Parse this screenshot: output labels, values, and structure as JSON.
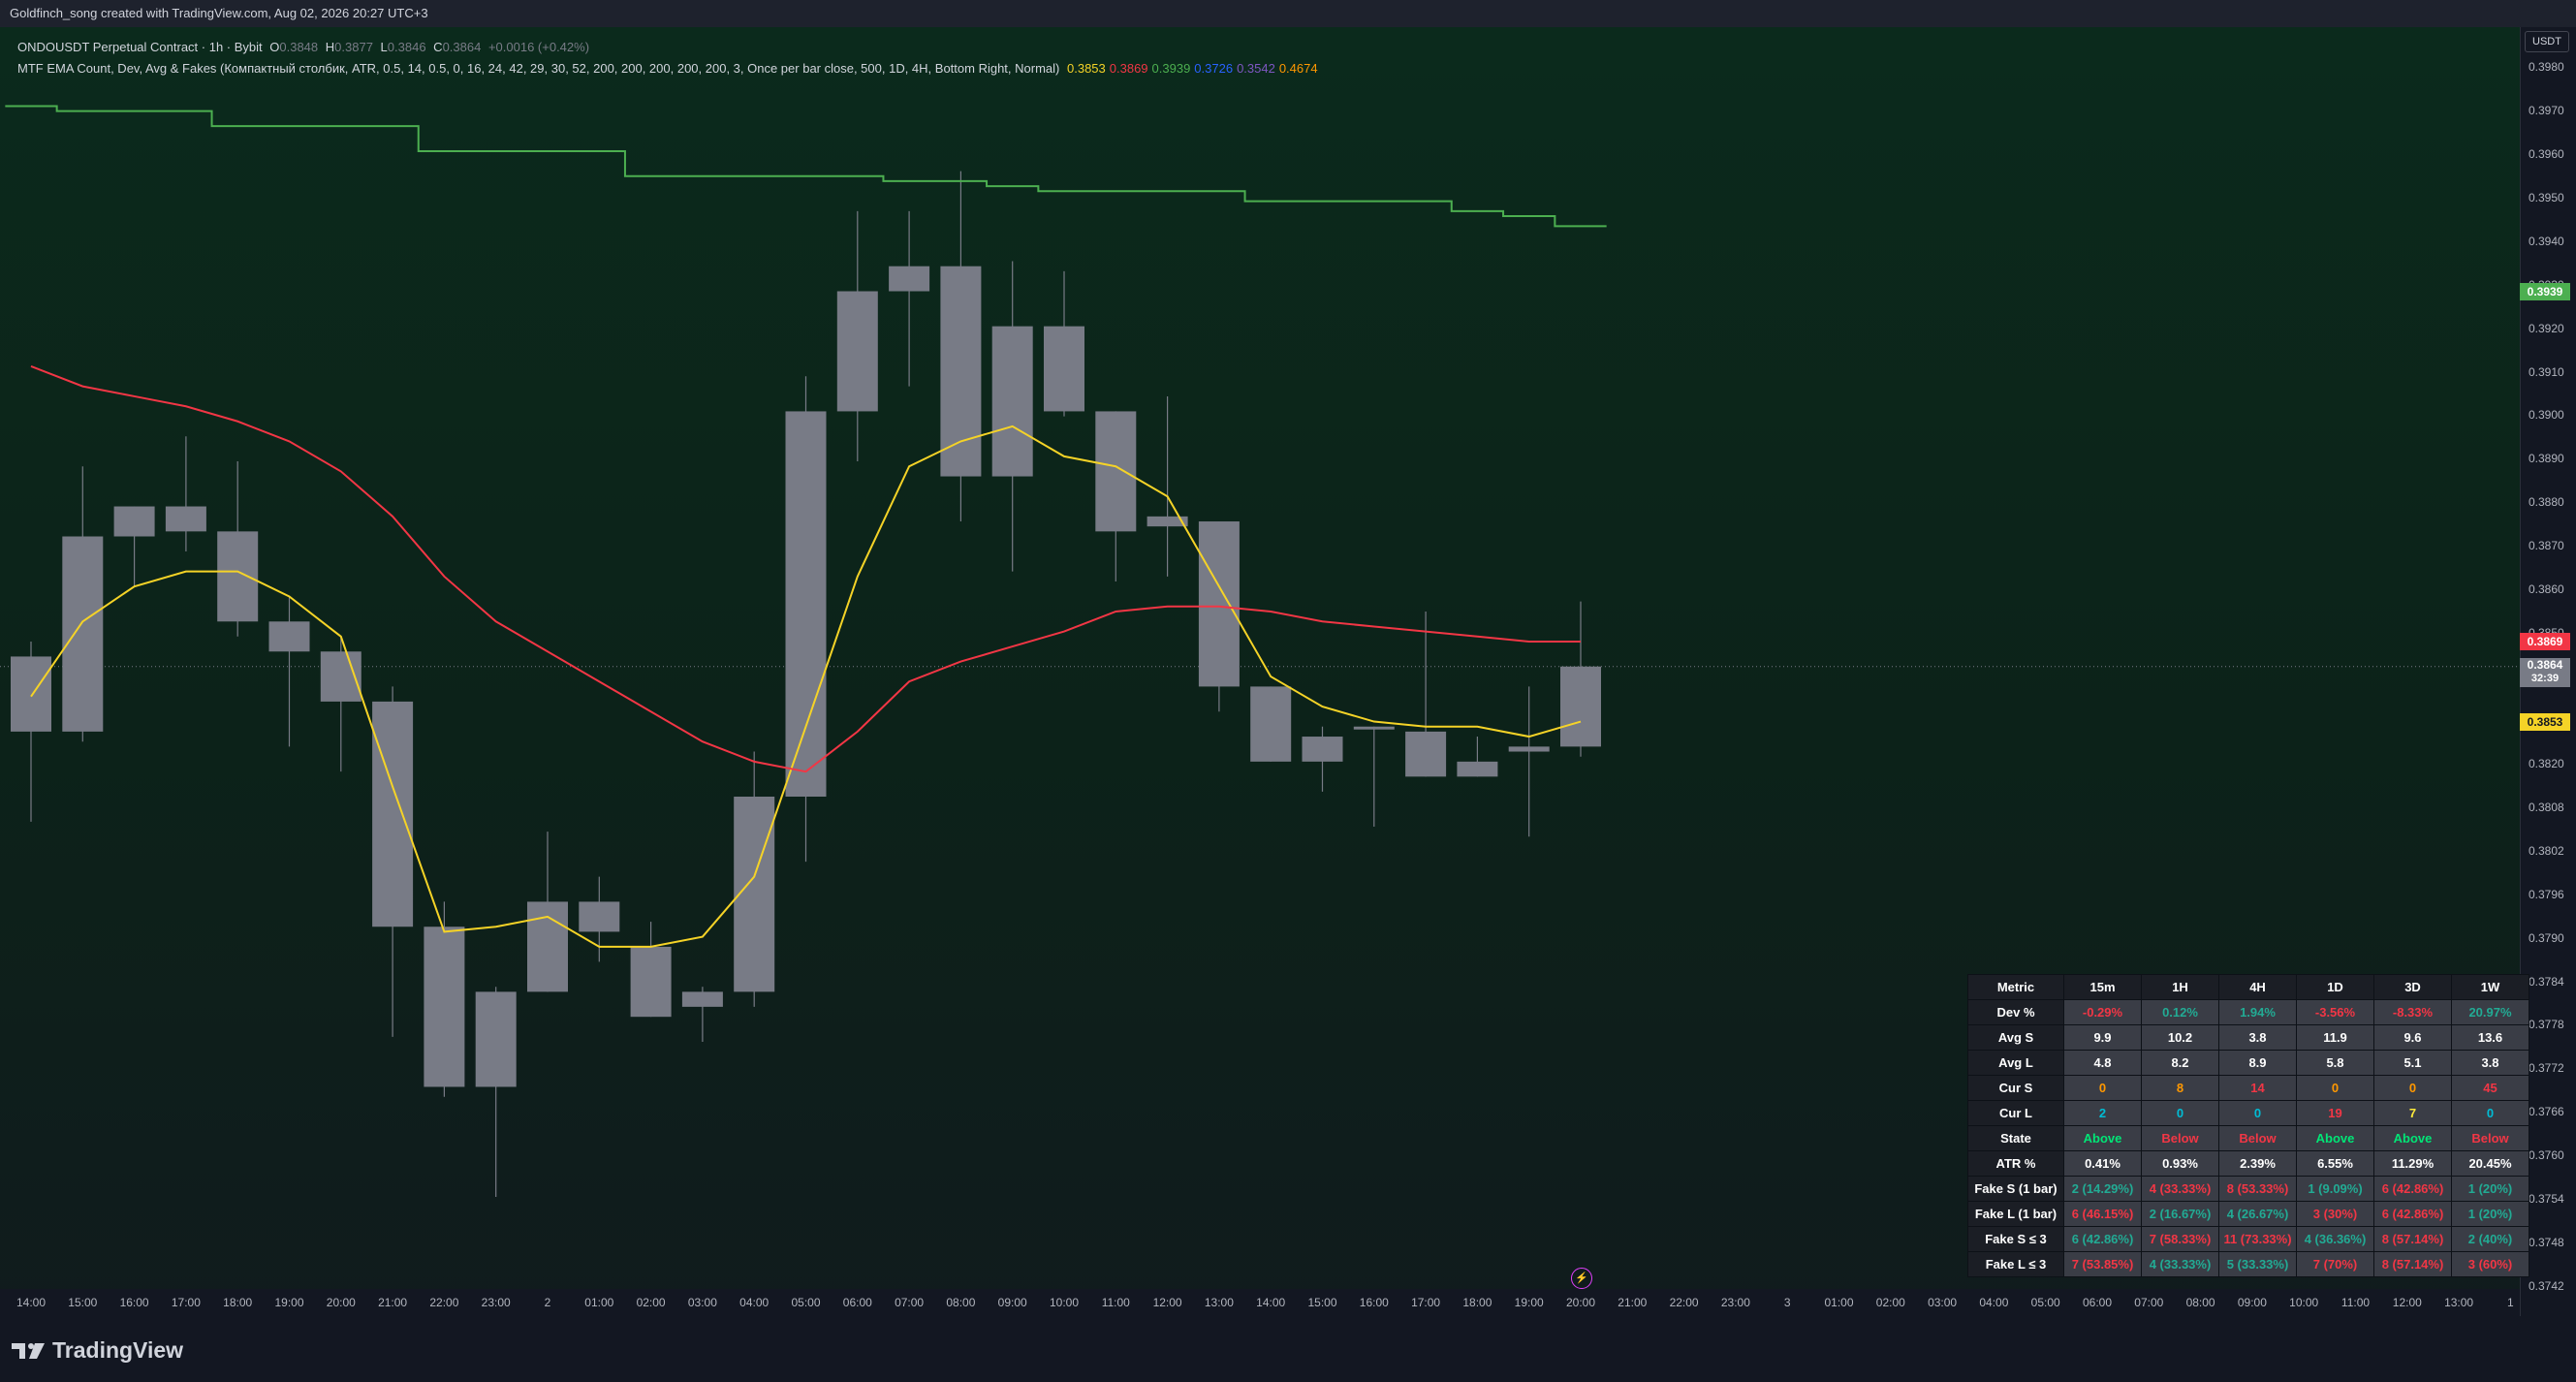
{
  "header": {
    "credit": "Goldfinch_song created with TradingView.com, Aug 02, 2026 20:27 UTC+3"
  },
  "legend": {
    "symbol_line": "ONDOUSDT Perpetual Contract · 1h · Bybit",
    "ohlc": {
      "o_label": "O",
      "o": "0.3848",
      "h_label": "H",
      "h": "0.3877",
      "l_label": "L",
      "l": "0.3846",
      "c_label": "C",
      "c": "0.3864",
      "change": "+0.0016 (+0.42%)"
    },
    "indicator_line": "MTF EMA Count, Dev, Avg & Fakes (Компактный столбик, ATR, 0.5, 14, 0.5, 0, 16, 24, 42, 29, 30, 52, 200, 200, 200, 200, 200, 3, Once per bar close, 500, 1D, 4H, Bottom Right, Normal)",
    "indicator_values": [
      {
        "text": "0.3853",
        "color": "#f5d327"
      },
      {
        "text": "0.3869",
        "color": "#f23645"
      },
      {
        "text": "0.3939",
        "color": "#4caf50"
      },
      {
        "text": "0.3726",
        "color": "#2962ff"
      },
      {
        "text": "0.3542",
        "color": "#7e57c2"
      },
      {
        "text": "0.4674",
        "color": "#ff9800"
      }
    ]
  },
  "price_axis": {
    "currency": "USDT",
    "ticks": [
      "0.3980",
      "0.3970",
      "0.3960",
      "0.3950",
      "0.3940",
      "0.3930",
      "0.3920",
      "0.3910",
      "0.3900",
      "0.3890",
      "0.3880",
      "0.3870",
      "0.3860",
      "0.3850",
      "0.3840",
      "0.3830",
      "0.3820",
      "0.3808",
      "0.3802",
      "0.3796",
      "0.3790",
      "0.3784",
      "0.3778",
      "0.3772",
      "0.3766",
      "0.3760",
      "0.3754",
      "0.3748",
      "0.3742"
    ],
    "tags": [
      {
        "text": "0.3939",
        "bg": "#4caf50",
        "fg": "#ffffff",
        "price": 0.3939
      },
      {
        "text": "0.3869",
        "bg": "#f23645",
        "fg": "#ffffff",
        "price": 0.3869
      },
      {
        "text": "0.3864",
        "sub": "32:39",
        "bg": "#787b86",
        "fg": "#ffffff",
        "price": 0.3864
      },
      {
        "text": "0.3853",
        "bg": "#f5d327",
        "fg": "#131722",
        "price": 0.3853
      }
    ]
  },
  "time_axis": {
    "labels": [
      "14:00",
      "15:00",
      "16:00",
      "17:00",
      "18:00",
      "19:00",
      "20:00",
      "21:00",
      "22:00",
      "23:00",
      "2",
      "01:00",
      "02:00",
      "03:00",
      "04:00",
      "05:00",
      "06:00",
      "07:00",
      "08:00",
      "09:00",
      "10:00",
      "11:00",
      "12:00",
      "13:00",
      "14:00",
      "15:00",
      "16:00",
      "17:00",
      "18:00",
      "19:00",
      "20:00",
      "21:00",
      "22:00",
      "23:00",
      "3",
      "01:00",
      "02:00",
      "03:00",
      "04:00",
      "05:00",
      "06:00",
      "07:00",
      "08:00",
      "09:00",
      "10:00",
      "11:00",
      "12:00",
      "13:00",
      "1"
    ]
  },
  "chart_data": {
    "type": "candlestick",
    "candle_color": "#787b86",
    "categories": [
      "14:00",
      "15:00",
      "16:00",
      "17:00",
      "18:00",
      "19:00",
      "20:00",
      "21:00",
      "22:00",
      "23:00",
      "2",
      "01:00",
      "02:00",
      "03:00",
      "04:00",
      "05:00",
      "06:00",
      "07:00",
      "08:00",
      "09:00",
      "10:00",
      "11:00",
      "12:00",
      "13:00",
      "14:00",
      "15:00",
      "16:00",
      "17:00",
      "18:00",
      "19:00",
      "20:00"
    ],
    "ohlc": [
      [
        0.3866,
        0.3869,
        0.3833,
        0.3851
      ],
      [
        0.3851,
        0.3904,
        0.3849,
        0.389
      ],
      [
        0.389,
        0.3896,
        0.388,
        0.3896
      ],
      [
        0.3896,
        0.391,
        0.3887,
        0.3891
      ],
      [
        0.3891,
        0.3905,
        0.387,
        0.3873
      ],
      [
        0.3873,
        0.3878,
        0.3848,
        0.3867
      ],
      [
        0.3867,
        0.387,
        0.3843,
        0.3857
      ],
      [
        0.3857,
        0.386,
        0.379,
        0.3812
      ],
      [
        0.3812,
        0.3817,
        0.3778,
        0.378
      ],
      [
        0.378,
        0.38,
        0.3758,
        0.3799
      ],
      [
        0.3799,
        0.3831,
        0.3799,
        0.3817
      ],
      [
        0.3817,
        0.3822,
        0.3805,
        0.3811
      ],
      [
        0.3808,
        0.3813,
        0.3794,
        0.3794
      ],
      [
        0.3796,
        0.38,
        0.3789,
        0.3799
      ],
      [
        0.3799,
        0.3847,
        0.3796,
        0.3838
      ],
      [
        0.3838,
        0.3922,
        0.3825,
        0.3915
      ],
      [
        0.3915,
        0.3955,
        0.3905,
        0.3939
      ],
      [
        0.3939,
        0.3955,
        0.392,
        0.3944
      ],
      [
        0.3944,
        0.3963,
        0.3893,
        0.3902
      ],
      [
        0.3902,
        0.3945,
        0.3883,
        0.3932
      ],
      [
        0.3932,
        0.3943,
        0.3914,
        0.3915
      ],
      [
        0.3915,
        0.3915,
        0.3881,
        0.3891
      ],
      [
        0.3892,
        0.3918,
        0.3882,
        0.3894
      ],
      [
        0.3893,
        0.3893,
        0.3855,
        0.386
      ],
      [
        0.386,
        0.386,
        0.3845,
        0.3845
      ],
      [
        0.3845,
        0.3852,
        0.3839,
        0.385
      ],
      [
        0.3852,
        0.3852,
        0.3832,
        0.3852
      ],
      [
        0.3851,
        0.3875,
        0.3842,
        0.3842
      ],
      [
        0.3842,
        0.385,
        0.3842,
        0.3845
      ],
      [
        0.3847,
        0.386,
        0.383,
        0.3848
      ],
      [
        0.3848,
        0.3877,
        0.3846,
        0.3864
      ]
    ],
    "series": [
      {
        "color": "#f5d327",
        "values": [
          0.3858,
          0.3873,
          0.388,
          0.3883,
          0.3883,
          0.3878,
          0.387,
          0.384,
          0.3811,
          0.3812,
          0.3814,
          0.3808,
          0.3808,
          0.381,
          0.3822,
          0.3852,
          0.3882,
          0.3904,
          0.3909,
          0.3912,
          0.3906,
          0.3904,
          0.3898,
          0.388,
          0.3862,
          0.3856,
          0.3853,
          0.3852,
          0.3852,
          0.385,
          0.3853
        ]
      },
      {
        "color": "#f23645",
        "values": [
          0.3924,
          0.392,
          0.3918,
          0.3916,
          0.3913,
          0.3909,
          0.3903,
          0.3894,
          0.3882,
          0.3873,
          0.3867,
          0.3861,
          0.3855,
          0.3849,
          0.3845,
          0.3843,
          0.3851,
          0.3861,
          0.3865,
          0.3868,
          0.3871,
          0.3875,
          0.3876,
          0.3876,
          0.3875,
          0.3873,
          0.3872,
          0.3871,
          0.387,
          0.3869,
          0.3869
        ]
      },
      {
        "color": "#4caf50",
        "values": [
          0.3976,
          0.3975,
          0.3975,
          0.3975,
          0.3972,
          0.3972,
          0.3972,
          0.3972,
          0.3967,
          0.3967,
          0.3967,
          0.3967,
          0.3962,
          0.3962,
          0.3962,
          0.3962,
          0.3962,
          0.3961,
          0.3961,
          0.396,
          0.3959,
          0.3959,
          0.3959,
          0.3959,
          0.3957,
          0.3957,
          0.3957,
          0.3957,
          0.3955,
          0.3954,
          0.3952
        ]
      }
    ],
    "ylim": [
      0.374,
      0.3985
    ]
  },
  "table": {
    "headers": [
      "Metric",
      "15m",
      "1H",
      "4H",
      "1D",
      "3D",
      "1W"
    ],
    "rows": [
      {
        "metric": "Dev %",
        "cells": [
          {
            "t": "-0.29%",
            "c": "#f23645"
          },
          {
            "t": "0.12%",
            "c": "#22ab94"
          },
          {
            "t": "1.94%",
            "c": "#22ab94"
          },
          {
            "t": "-3.56%",
            "c": "#f23645"
          },
          {
            "t": "-8.33%",
            "c": "#f23645"
          },
          {
            "t": "20.97%",
            "c": "#22ab94"
          }
        ]
      },
      {
        "metric": "Avg S",
        "cells": [
          {
            "t": "9.9",
            "c": "#ffffff"
          },
          {
            "t": "10.2",
            "c": "#ffffff"
          },
          {
            "t": "3.8",
            "c": "#ffffff"
          },
          {
            "t": "11.9",
            "c": "#ffffff"
          },
          {
            "t": "9.6",
            "c": "#ffffff"
          },
          {
            "t": "13.6",
            "c": "#ffffff"
          }
        ]
      },
      {
        "metric": "Avg L",
        "cells": [
          {
            "t": "4.8",
            "c": "#ffffff"
          },
          {
            "t": "8.2",
            "c": "#ffffff"
          },
          {
            "t": "8.9",
            "c": "#ffffff"
          },
          {
            "t": "5.8",
            "c": "#ffffff"
          },
          {
            "t": "5.1",
            "c": "#ffffff"
          },
          {
            "t": "3.8",
            "c": "#ffffff"
          }
        ]
      },
      {
        "metric": "Cur S",
        "cells": [
          {
            "t": "0",
            "c": "#ff9800"
          },
          {
            "t": "8",
            "c": "#ff9800"
          },
          {
            "t": "14",
            "c": "#f23645"
          },
          {
            "t": "0",
            "c": "#ff9800"
          },
          {
            "t": "0",
            "c": "#ff9800"
          },
          {
            "t": "45",
            "c": "#f23645"
          }
        ]
      },
      {
        "metric": "Cur L",
        "cells": [
          {
            "t": "2",
            "c": "#00bcd4"
          },
          {
            "t": "0",
            "c": "#00bcd4"
          },
          {
            "t": "0",
            "c": "#00bcd4"
          },
          {
            "t": "19",
            "c": "#f23645"
          },
          {
            "t": "7",
            "c": "#ffeb3b"
          },
          {
            "t": "0",
            "c": "#00bcd4"
          }
        ]
      },
      {
        "metric": "State",
        "cells": [
          {
            "t": "Above",
            "c": "#00e676"
          },
          {
            "t": "Below",
            "c": "#f23645"
          },
          {
            "t": "Below",
            "c": "#f23645"
          },
          {
            "t": "Above",
            "c": "#00e676"
          },
          {
            "t": "Above",
            "c": "#00e676"
          },
          {
            "t": "Below",
            "c": "#f23645"
          }
        ]
      },
      {
        "metric": "ATR %",
        "cells": [
          {
            "t": "0.41%",
            "c": "#ffffff"
          },
          {
            "t": "0.93%",
            "c": "#ffffff"
          },
          {
            "t": "2.39%",
            "c": "#ffffff"
          },
          {
            "t": "6.55%",
            "c": "#ffffff"
          },
          {
            "t": "11.29%",
            "c": "#ffffff"
          },
          {
            "t": "20.45%",
            "c": "#ffffff"
          }
        ]
      },
      {
        "metric": "Fake S (1 bar)",
        "cells": [
          {
            "t": "2 (14.29%)",
            "c": "#22ab94"
          },
          {
            "t": "4 (33.33%)",
            "c": "#f23645"
          },
          {
            "t": "8 (53.33%)",
            "c": "#f23645"
          },
          {
            "t": "1 (9.09%)",
            "c": "#22ab94"
          },
          {
            "t": "6 (42.86%)",
            "c": "#f23645"
          },
          {
            "t": "1 (20%)",
            "c": "#22ab94"
          }
        ]
      },
      {
        "metric": "Fake L (1 bar)",
        "cells": [
          {
            "t": "6 (46.15%)",
            "c": "#f23645"
          },
          {
            "t": "2 (16.67%)",
            "c": "#22ab94"
          },
          {
            "t": "4 (26.67%)",
            "c": "#22ab94"
          },
          {
            "t": "3 (30%)",
            "c": "#f23645"
          },
          {
            "t": "6 (42.86%)",
            "c": "#f23645"
          },
          {
            "t": "1 (20%)",
            "c": "#22ab94"
          }
        ]
      },
      {
        "metric": "Fake S ≤ 3",
        "cells": [
          {
            "t": "6 (42.86%)",
            "c": "#22ab94"
          },
          {
            "t": "7 (58.33%)",
            "c": "#f23645"
          },
          {
            "t": "11 (73.33%)",
            "c": "#f23645"
          },
          {
            "t": "4 (36.36%)",
            "c": "#22ab94"
          },
          {
            "t": "8 (57.14%)",
            "c": "#f23645"
          },
          {
            "t": "2 (40%)",
            "c": "#22ab94"
          }
        ]
      },
      {
        "metric": "Fake L ≤ 3",
        "cells": [
          {
            "t": "7 (53.85%)",
            "c": "#f23645"
          },
          {
            "t": "4 (33.33%)",
            "c": "#22ab94"
          },
          {
            "t": "5 (33.33%)",
            "c": "#22ab94"
          },
          {
            "t": "7 (70%)",
            "c": "#f23645"
          },
          {
            "t": "8 (57.14%)",
            "c": "#f23645"
          },
          {
            "t": "3 (60%)",
            "c": "#f23645"
          }
        ]
      }
    ]
  },
  "footer": {
    "brand": "TradingView"
  }
}
